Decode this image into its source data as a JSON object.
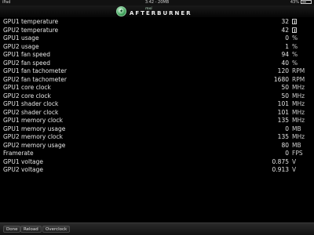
{
  "statusbar": {
    "device": "iPad",
    "time": "3:42 - 20MB",
    "battery": "43%"
  },
  "header": {
    "brand_small": "msi",
    "app_name": "AFTERBURNER",
    "logo_icon": "afterburner-logo-icon"
  },
  "rows": [
    {
      "label": "GPU1 temperature",
      "value": "32",
      "unit": "",
      "unit_icon": "degree-glyph-icon"
    },
    {
      "label": "GPU2 temperature",
      "value": "42",
      "unit": "",
      "unit_icon": "degree-glyph-icon"
    },
    {
      "label": "GPU1 usage",
      "value": "0",
      "unit": "%"
    },
    {
      "label": "GPU2 usage",
      "value": "1",
      "unit": "%"
    },
    {
      "label": "GPU1 fan speed",
      "value": "94",
      "unit": "%"
    },
    {
      "label": "GPU2 fan speed",
      "value": "40",
      "unit": "%"
    },
    {
      "label": "GPU1 fan tachometer",
      "value": "120",
      "unit": "RPM"
    },
    {
      "label": "GPU2 fan tachometer",
      "value": "1680",
      "unit": "RPM"
    },
    {
      "label": "GPU1 core clock",
      "value": "50",
      "unit": "MHz"
    },
    {
      "label": "GPU2 core clock",
      "value": "50",
      "unit": "MHz"
    },
    {
      "label": "GPU1 shader clock",
      "value": "101",
      "unit": "MHz"
    },
    {
      "label": "GPU2 shader clock",
      "value": "101",
      "unit": "MHz"
    },
    {
      "label": "GPU1 memory clock",
      "value": "135",
      "unit": "MHz"
    },
    {
      "label": "GPU1 memory usage",
      "value": "0",
      "unit": "MB"
    },
    {
      "label": "GPU2 memory clock",
      "value": "135",
      "unit": "MHz"
    },
    {
      "label": "GPU2 memory usage",
      "value": "80",
      "unit": "MB"
    },
    {
      "label": "Framerate",
      "value": "0",
      "unit": "FPS"
    },
    {
      "label": "GPU1 voltage",
      "value": "0.875",
      "unit": "V"
    },
    {
      "label": "GPU2 voltage",
      "value": "0.913",
      "unit": "V"
    }
  ],
  "bottombar": {
    "done_label": "Done",
    "reload_label": "Reload",
    "overclock_label": "Overclock"
  }
}
